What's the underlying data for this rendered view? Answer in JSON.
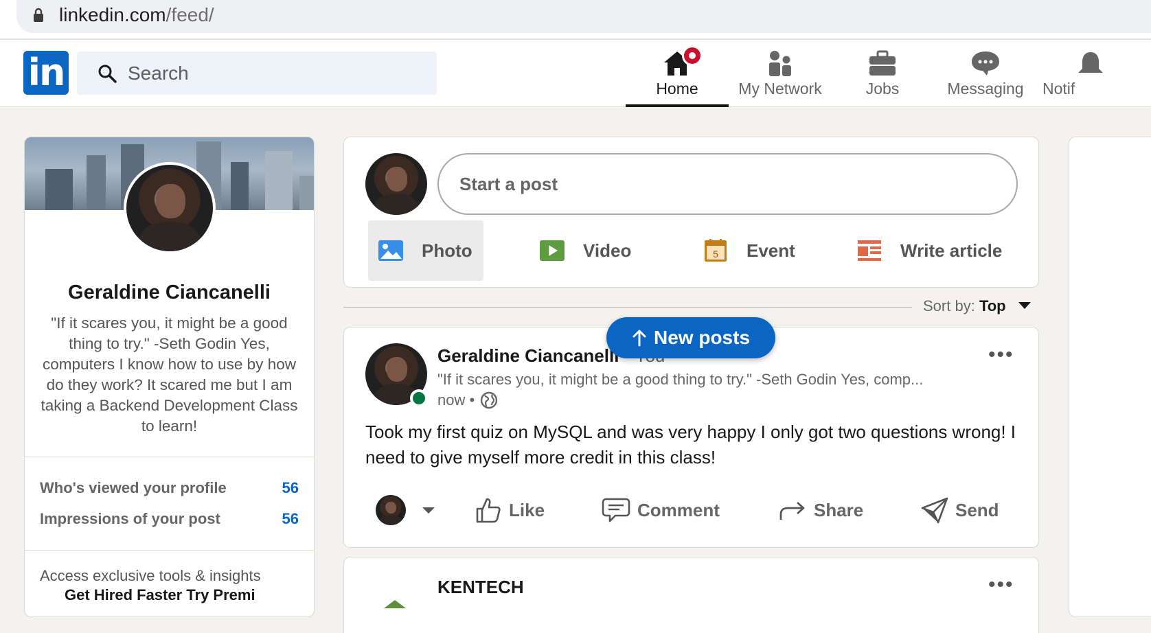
{
  "browser": {
    "url_domain": "linkedin.com",
    "url_path": "/feed/"
  },
  "nav": {
    "logo": "in",
    "search_placeholder": "Search",
    "items": [
      {
        "label": "Home",
        "icon": "home-icon"
      },
      {
        "label": "My Network",
        "icon": "network-icon"
      },
      {
        "label": "Jobs",
        "icon": "jobs-icon"
      },
      {
        "label": "Messaging",
        "icon": "messaging-icon"
      },
      {
        "label": "Notif",
        "icon": "notifications-icon"
      }
    ]
  },
  "profile": {
    "name": "Geraldine Ciancanelli",
    "headline": "\"If it scares you, it might be a good thing to try.\" -Seth Godin Yes, computers I know how to use by how do they work? It scared me but I am taking a Backend Development Class to learn!",
    "stats": [
      {
        "label": "Who's viewed your profile",
        "value": "56"
      },
      {
        "label": "Impressions of your post",
        "value": "56"
      }
    ],
    "insights_text": "Access exclusive tools & insights",
    "insights_cut": "Get Hired Faster Try Premi"
  },
  "share_box": {
    "start_post": "Start a post",
    "actions": [
      {
        "label": "Photo",
        "icon": "photo-icon",
        "color": "#378fe9"
      },
      {
        "label": "Video",
        "icon": "video-icon",
        "color": "#5f9b41"
      },
      {
        "label": "Event",
        "icon": "event-icon",
        "color": "#c37d16"
      },
      {
        "label": "Write article",
        "icon": "article-icon",
        "color": "#e06847"
      }
    ],
    "event_day": "5"
  },
  "sort": {
    "label": "Sort by:",
    "value": "Top"
  },
  "new_posts": {
    "label": "New posts"
  },
  "post": {
    "author": "Geraldine Ciancanelli",
    "author_suffix": " • You",
    "subtitle": "\"If it scares you, it might be a good thing to try.\" -Seth Godin Yes, comp...",
    "time": "now •",
    "text": "Took my first quiz on MySQL and was very happy I only got two questions wrong! I need to give myself more credit in this class!",
    "actions": [
      {
        "label": "Like",
        "icon": "like-icon"
      },
      {
        "label": "Comment",
        "icon": "comment-icon"
      },
      {
        "label": "Share",
        "icon": "share-icon"
      },
      {
        "label": "Send",
        "icon": "send-icon"
      }
    ],
    "more": "•••"
  },
  "next_post": {
    "company": "KENTECH",
    "more": "•••"
  },
  "colors": {
    "brand": "#0a66c2",
    "online": "#057642",
    "notification": "#cb112d",
    "background": "#f4f2ee"
  }
}
